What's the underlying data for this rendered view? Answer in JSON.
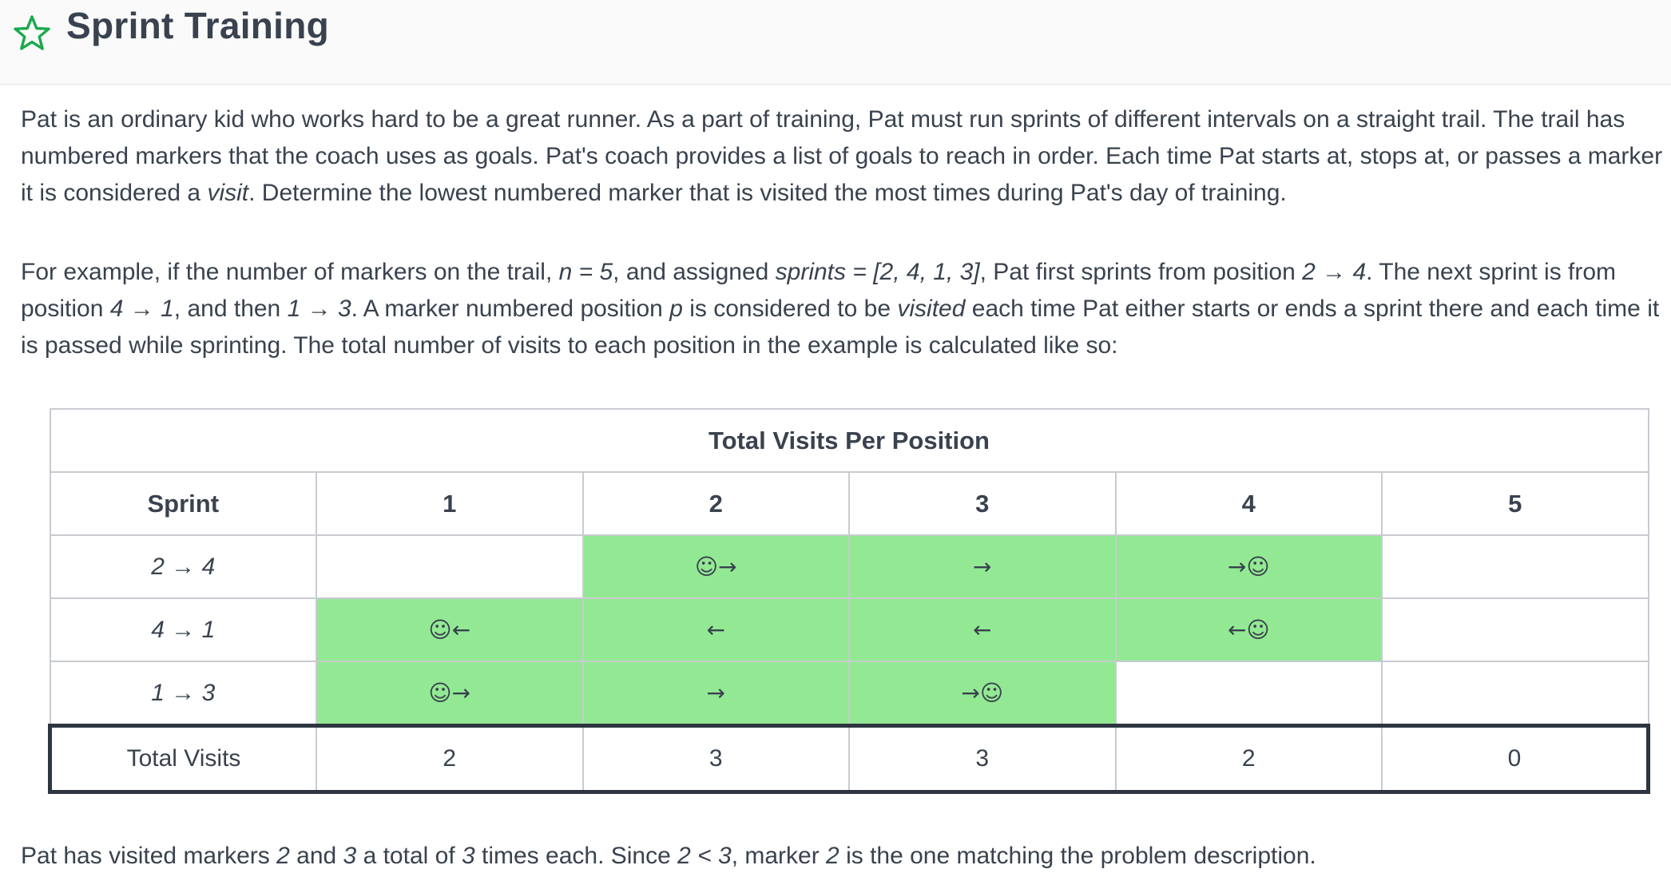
{
  "header": {
    "title": "Sprint Training",
    "icon": "star-outline-icon",
    "icon_color": "#1ba94c"
  },
  "intro": {
    "p1": [
      "Pat is an ordinary kid who works hard to be a great runner. As a part of training, Pat must run sprints of different intervals on a straight trail.  The trail has numbered markers that the coach uses as goals.  Pat's coach provides a list of goals to reach in order.  Each time Pat starts at, stops at, or passes a marker it is considered a ",
      "visit",
      ".  Determine the lowest numbered marker that is visited the most times during Pat's day of training."
    ],
    "p2": [
      "For example, if the number of markers on the trail,  ",
      "n = 5",
      ", and assigned ",
      "sprints = [2, 4, 1, 3]",
      ", Pat first sprints from position ",
      "2 → 4",
      ". The next sprint is from position ",
      "4 → 1",
      ", and then ",
      "1 → 3",
      ". A marker numbered position ",
      "p",
      " is considered to be ",
      "visited",
      " each time Pat either starts or ends a sprint there and each time it is passed while sprinting. The total number of visits to each position in the example is calculated like so:"
    ]
  },
  "table": {
    "caption": "Total Visits Per Position",
    "col_header": "Sprint",
    "positions": [
      "1",
      "2",
      "3",
      "4",
      "5"
    ],
    "rows": [
      {
        "sprint": "2 → 4",
        "cells": [
          "",
          "☺→",
          "→",
          "→☺",
          ""
        ],
        "filled": [
          false,
          true,
          true,
          true,
          false
        ]
      },
      {
        "sprint": "4 → 1",
        "cells": [
          "☺←",
          "←",
          "←",
          "←☺",
          ""
        ],
        "filled": [
          true,
          true,
          true,
          true,
          false
        ]
      },
      {
        "sprint": "1 → 3",
        "cells": [
          "☺→",
          "→",
          "→☺",
          "",
          ""
        ],
        "filled": [
          true,
          true,
          true,
          false,
          false
        ]
      }
    ],
    "total_label": "Total Visits",
    "totals": [
      "2",
      "3",
      "3",
      "2",
      "0"
    ],
    "highlight_color": "#93e993"
  },
  "conclusion": [
    "Pat has visited markers ",
    "2",
    " and ",
    "3",
    " a total of ",
    "3",
    " times each.  Since ",
    "2 < 3",
    ", marker ",
    "2",
    " is the one matching the problem description."
  ]
}
